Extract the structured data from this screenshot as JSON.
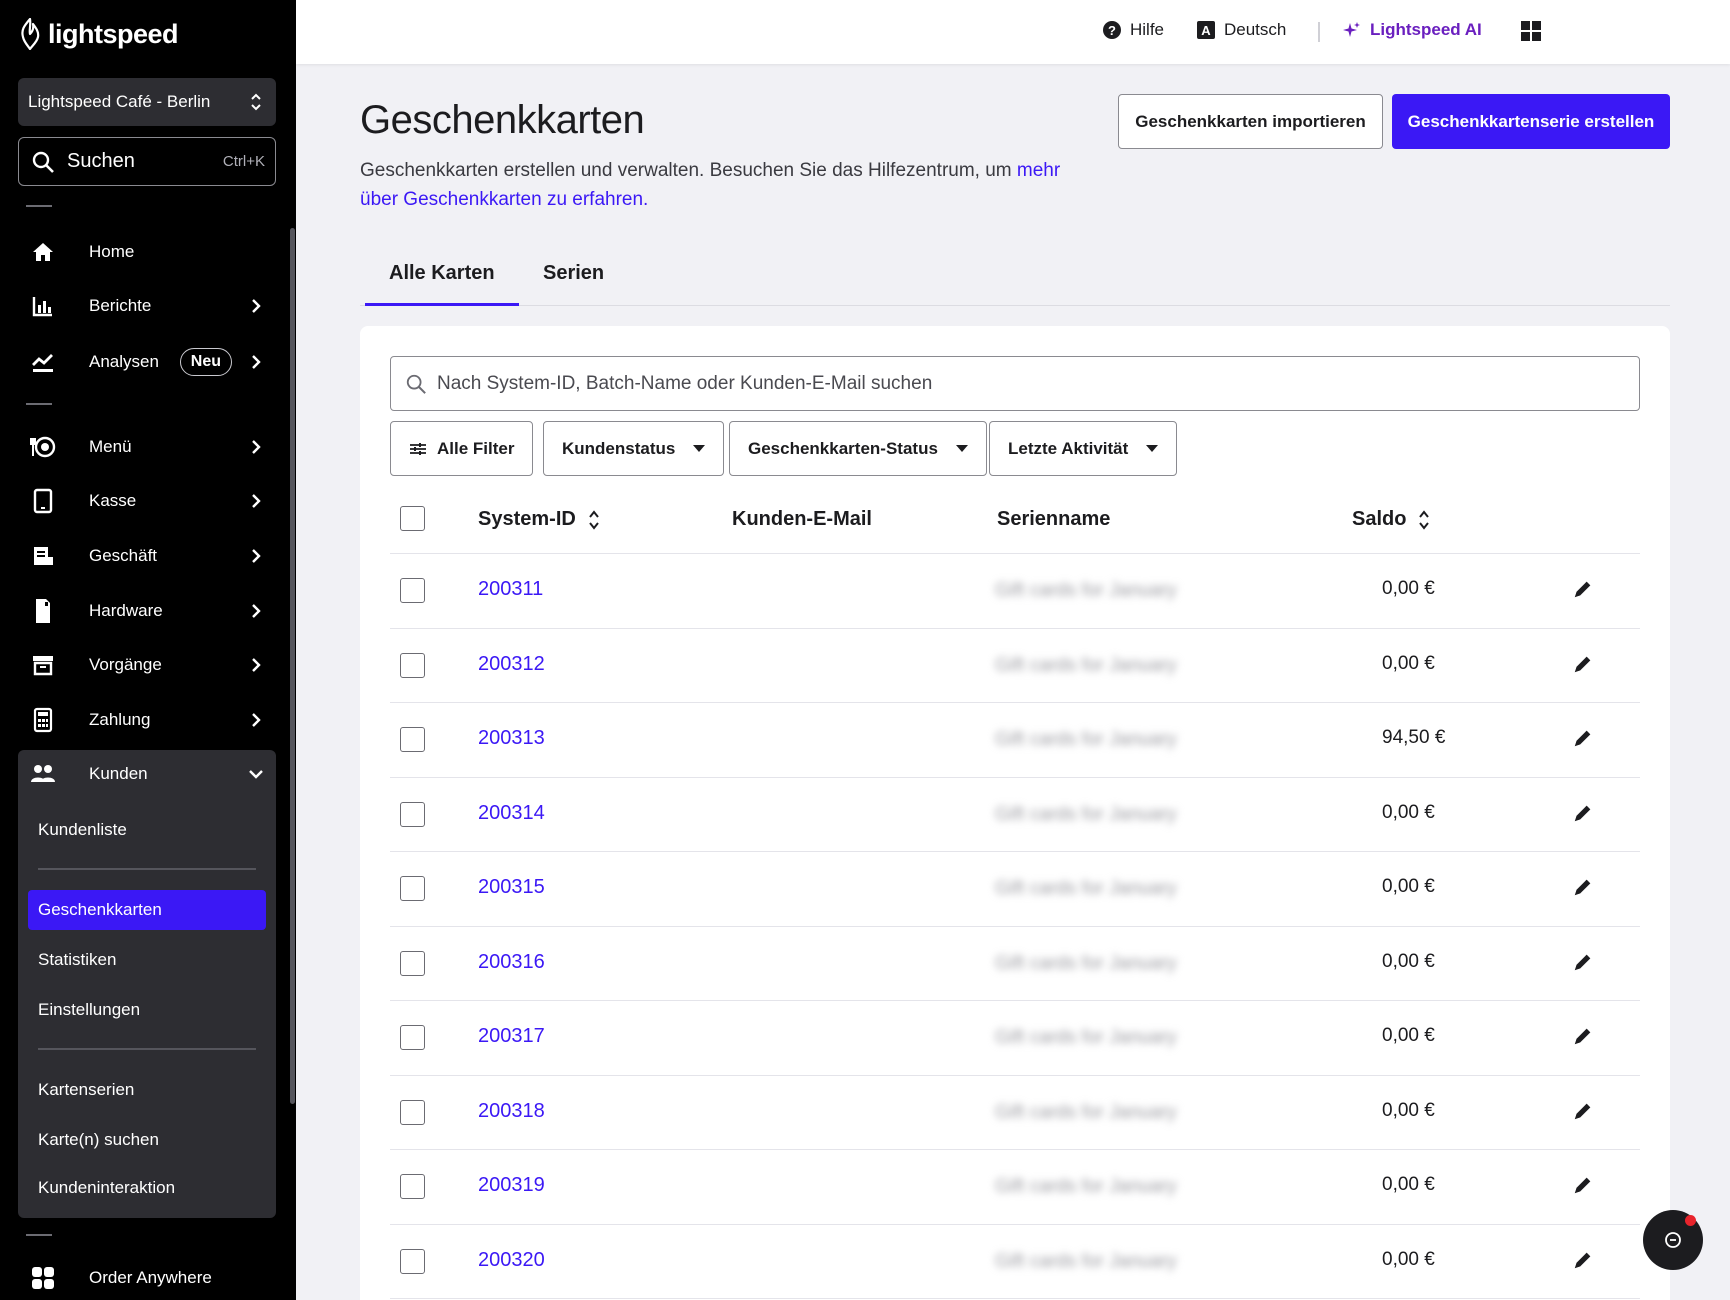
{
  "sidebar": {
    "logo_text": "lightspeed",
    "store_name": "Lightspeed Café - Berlin",
    "search_label": "Suchen",
    "search_shortcut": "Ctrl+K",
    "items": [
      {
        "label": "Home",
        "icon": "home-icon"
      },
      {
        "label": "Berichte",
        "icon": "bar-chart-icon"
      },
      {
        "label": "Analysen",
        "icon": "trend-icon",
        "badge": "Neu"
      },
      {
        "label": "Menü",
        "icon": "menu-plate-icon"
      },
      {
        "label": "Kasse",
        "icon": "tablet-icon"
      },
      {
        "label": "Geschäft",
        "icon": "store-icon"
      },
      {
        "label": "Hardware",
        "icon": "device-icon"
      },
      {
        "label": "Vorgänge",
        "icon": "archive-icon"
      },
      {
        "label": "Zahlung",
        "icon": "calculator-icon"
      },
      {
        "label": "Kunden",
        "icon": "users-icon"
      }
    ],
    "kunden_sub": [
      "Kundenliste",
      "Geschenkkarten",
      "Statistiken",
      "Einstellungen",
      "Kartenserien",
      "Karte(n) suchen",
      "Kundeninteraktion"
    ],
    "bottom_item": "Order Anywhere"
  },
  "topbar": {
    "help": "Hilfe",
    "language": "Deutsch",
    "ai": "Lightspeed AI"
  },
  "page": {
    "title": "Geschenkkarten",
    "description": "Geschenkkarten erstellen und verwalten. Besuchen Sie das Hilfezentrum, um ",
    "description_link": "mehr über Geschenkkarten zu erfahren.",
    "import_button": "Geschenkkarten importieren",
    "create_button": "Geschenkkartenserie erstellen",
    "tabs": [
      "Alle Karten",
      "Serien"
    ]
  },
  "table": {
    "search_placeholder": "Nach System-ID, Batch-Name oder Kunden-E-Mail suchen",
    "filters": [
      "Alle Filter",
      "Kundenstatus",
      "Geschenkkarten-Status",
      "Letzte Aktivität"
    ],
    "columns": [
      "System-ID",
      "Kunden-E-Mail",
      "Serienname",
      "Saldo"
    ],
    "rows": [
      {
        "id": "200311",
        "series": "Gift cards for January",
        "saldo": "0,00 €"
      },
      {
        "id": "200312",
        "series": "Gift cards for January",
        "saldo": "0,00 €"
      },
      {
        "id": "200313",
        "series": "Gift cards for January",
        "saldo": "94,50 €"
      },
      {
        "id": "200314",
        "series": "Gift cards for January",
        "saldo": "0,00 €"
      },
      {
        "id": "200315",
        "series": "Gift cards for January",
        "saldo": "0,00 €"
      },
      {
        "id": "200316",
        "series": "Gift cards for January",
        "saldo": "0,00 €"
      },
      {
        "id": "200317",
        "series": "Gift cards for January",
        "saldo": "0,00 €"
      },
      {
        "id": "200318",
        "series": "Gift cards for January",
        "saldo": "0,00 €"
      },
      {
        "id": "200319",
        "series": "Gift cards for January",
        "saldo": "0,00 €"
      },
      {
        "id": "200320",
        "series": "Gift cards for January",
        "saldo": "0,00 €"
      }
    ]
  },
  "colors": {
    "accent": "#3b18f5",
    "ai": "#6a1fbf",
    "sidebar_bg": "#000000"
  }
}
